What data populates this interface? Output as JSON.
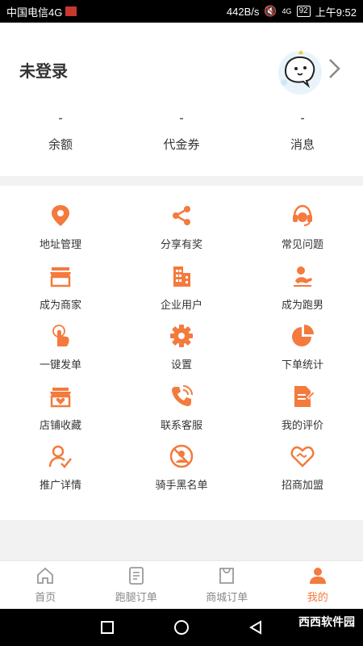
{
  "status_bar": {
    "carrier": "中国电信4G",
    "net_speed": "442B/s",
    "signal": "4G",
    "battery": "92",
    "time": "上午9:52"
  },
  "profile": {
    "username": "未登录",
    "stats": [
      {
        "value": "-",
        "label": "余额"
      },
      {
        "value": "-",
        "label": "代金券"
      },
      {
        "value": "-",
        "label": "消息"
      }
    ]
  },
  "menu": {
    "accent_color": "#f47a3d",
    "items": [
      {
        "label": "地址管理",
        "icon": "location-pin-icon"
      },
      {
        "label": "分享有奖",
        "icon": "share-icon"
      },
      {
        "label": "常见问题",
        "icon": "headset-icon"
      },
      {
        "label": "成为商家",
        "icon": "storefront-icon"
      },
      {
        "label": "企业用户",
        "icon": "building-icon"
      },
      {
        "label": "成为跑男",
        "icon": "runner-icon"
      },
      {
        "label": "一键发单",
        "icon": "tap-hand-icon"
      },
      {
        "label": "设置",
        "icon": "gear-icon"
      },
      {
        "label": "下单统计",
        "icon": "pie-chart-icon"
      },
      {
        "label": "店铺收藏",
        "icon": "shop-heart-icon"
      },
      {
        "label": "联系客服",
        "icon": "phone-icon"
      },
      {
        "label": "我的评价",
        "icon": "edit-document-icon"
      },
      {
        "label": "推广详情",
        "icon": "user-check-icon"
      },
      {
        "label": "骑手黑名单",
        "icon": "block-user-icon"
      },
      {
        "label": "招商加盟",
        "icon": "handshake-heart-icon"
      }
    ]
  },
  "tabbar": {
    "active_color": "#f47a3d",
    "items": [
      {
        "label": "首页",
        "icon": "home-icon"
      },
      {
        "label": "跑腿订单",
        "icon": "order-list-icon"
      },
      {
        "label": "商城订单",
        "icon": "shopping-bag-icon"
      },
      {
        "label": "我的",
        "icon": "user-icon",
        "active": true
      }
    ]
  },
  "watermark": "西西软件园"
}
